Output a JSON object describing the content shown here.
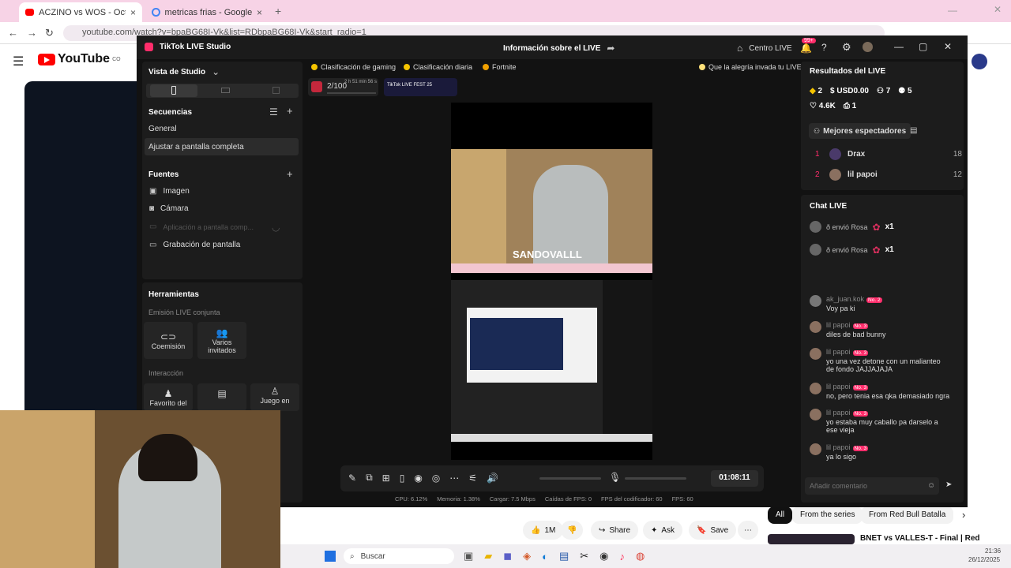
{
  "browser": {
    "tabs": [
      {
        "title": "ACZINO vs WOS - Octavos | Re"
      },
      {
        "title": "metricas frias - Google Search"
      }
    ],
    "url": "youtube.com/watch?v=bpaBG68I-Vk&list=RDbpaBG68I-Vk&start_radio=1"
  },
  "youtube": {
    "logo": "YouTube",
    "logo_sup": "CO",
    "actions": {
      "likes": "1M",
      "share": "Share",
      "ask": "Ask",
      "save": "Save"
    },
    "filters": [
      "All",
      "From the series",
      "From Red Bull Batalla"
    ],
    "next_video": "BNET vs VALLES-T - Final | Red"
  },
  "studio": {
    "app_title": "TikTok LIVE Studio",
    "window_title": "Información sobre el LIVE",
    "centro": "Centro LIVE",
    "notif_count": "99+",
    "left": {
      "view": "Vista de Studio",
      "sequences_header": "Secuencias",
      "sequences": [
        "General",
        "Ajustar a pantalla completa"
      ],
      "sources_header": "Fuentes",
      "sources": [
        "Imagen",
        "Cámara",
        "Aplicación a pantalla comp...",
        "Grabación de pantalla"
      ],
      "tools_header": "Herramientas",
      "joint_header": "Emisión LIVE conjunta",
      "joint": [
        "Coemisión",
        "Varios invitados"
      ],
      "interaction_header": "Interacción",
      "interaction": [
        "Favorito del",
        "Juego en"
      ]
    },
    "chips": [
      "Clasificación de gaming",
      "Clasificación diaria",
      "Fortnite",
      "Que la alegría invada tu LIVE"
    ],
    "goal": "2/100",
    "goal_time": "2 h 51 min 56 s",
    "fest": "TikTok LIVE FEST 25",
    "overlay_name": "SANDOVALLL",
    "timer": "01:08:11",
    "stats": {
      "cpu": "CPU: 6.12%",
      "mem": "Memoria: 1.38%",
      "load": "Cargar: 7.5 Mbps",
      "fps_drop": "Caídas de FPS: 0",
      "enc_fps": "FPS del codificador: 60",
      "fps": "FPS: 60"
    },
    "results": {
      "header": "Resultados del LIVE",
      "gifts": "2",
      "usd": "USD0.00",
      "viewers": "7",
      "follows": "5",
      "likes": "4.6K",
      "shares": "1",
      "top_label": "Mejores espectadores",
      "top": [
        {
          "rank": "1",
          "name": "Drax",
          "score": "18"
        },
        {
          "rank": "2",
          "name": "lil papoi",
          "score": "12"
        }
      ]
    },
    "chat": {
      "header": "Chat LIVE",
      "gifts": [
        {
          "text": "ð envió Rosa",
          "count": "x1"
        },
        {
          "text": "ð envió Rosa",
          "count": "x1"
        }
      ],
      "messages": [
        {
          "user": "ak_juan.kok",
          "badge": "No. 2",
          "text": "Voy pa ki"
        },
        {
          "user": "lil papoi",
          "badge": "No. 3",
          "text": "diles de bad bunny"
        },
        {
          "user": "lil papoi",
          "badge": "No. 3",
          "text": "yo una vez detone con un malianteo de fondo JAJJAJAJA"
        },
        {
          "user": "lil papoi",
          "badge": "No. 3",
          "text": "no, pero tenia esa qka demasiado ngra"
        },
        {
          "user": "lil papoi",
          "badge": "No. 3",
          "text": "yo estaba muy caballo pa darselo a ese vieja"
        },
        {
          "user": "lil papoi",
          "badge": "No. 3",
          "text": "ya lo sigo"
        }
      ],
      "placeholder": "Añadir comentario"
    }
  },
  "taskbar": {
    "search": "Buscar",
    "time": "21:36",
    "date": "26/12/2025"
  }
}
